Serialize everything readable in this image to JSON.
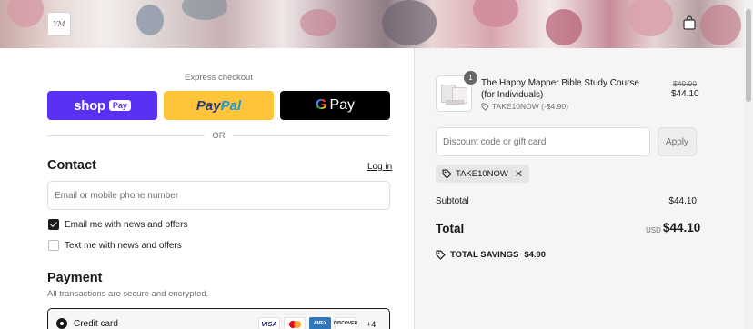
{
  "header": {
    "logo_text": "YM",
    "cart_icon": "shopping-bag-icon"
  },
  "express": {
    "label": "Express checkout",
    "shop_pay": {
      "word": "shop",
      "pill": "Pay"
    },
    "paypal": {
      "part1": "Pay",
      "part2": "Pal"
    },
    "gpay": {
      "g": "G",
      "word": "Pay"
    },
    "or": "OR"
  },
  "contact": {
    "heading": "Contact",
    "login": "Log in",
    "placeholder": "Email or mobile phone number",
    "email_opt": {
      "label": "Email me with news and offers",
      "checked": true
    },
    "text_opt": {
      "label": "Text me with news and offers",
      "checked": false
    }
  },
  "payment": {
    "heading": "Payment",
    "note": "All transactions are secure and encrypted.",
    "method_label": "Credit card",
    "cards": [
      "VISA",
      "MC",
      "AMEX",
      "DISCOVER"
    ],
    "more": "+4"
  },
  "summary": {
    "item": {
      "quantity": "1",
      "title": "The Happy Mapper Bible Study Course (for Individuals)",
      "discount_line": "TAKE10NOW (-$4.90)",
      "original_price": "$49.00",
      "price": "$44.10"
    },
    "discount_placeholder": "Discount code or gift card",
    "apply": "Apply",
    "applied_code": "TAKE10NOW",
    "subtotal_label": "Subtotal",
    "subtotal_value": "$44.10",
    "total_label": "Total",
    "total_currency": "USD",
    "total_value": "$44.10",
    "savings_label": "TOTAL SAVINGS",
    "savings_value": "$4.90"
  },
  "colors": {
    "shop_pay": "#5a31f4",
    "paypal": "#ffc439",
    "gpay": "#000000",
    "summary_bg": "#f5f5f5"
  }
}
